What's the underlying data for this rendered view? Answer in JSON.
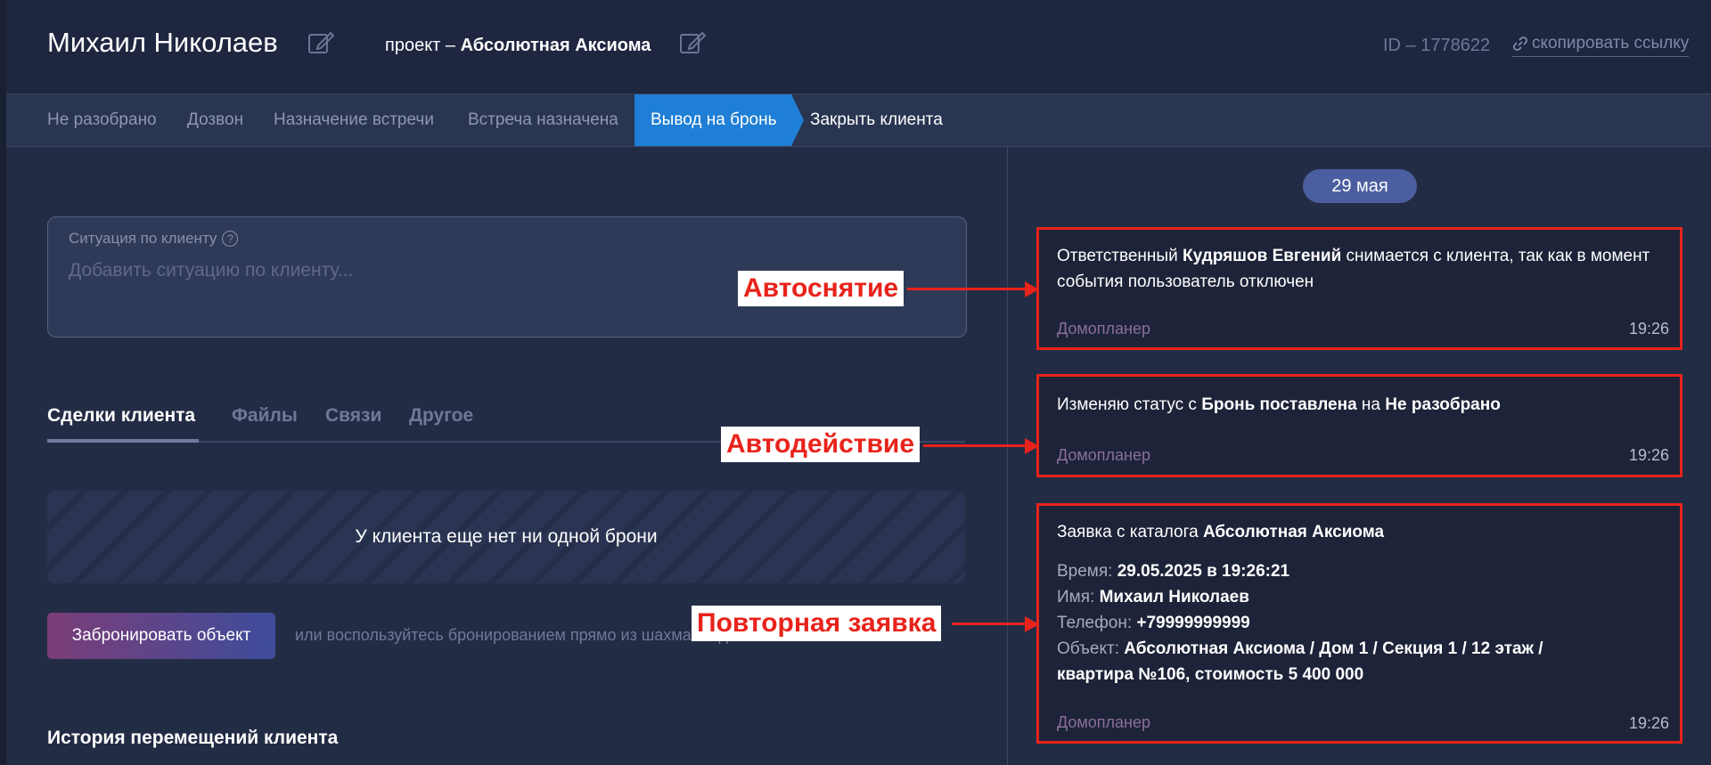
{
  "header": {
    "client_name": "Михаил Николаев",
    "project_prefix": "проект – ",
    "project_name": "Абсолютная Аксиома",
    "id_label": "ID – 1778622",
    "copy_link": "скопировать ссылку"
  },
  "stages": [
    "Не разобрано",
    "Дозвон",
    "Назначение встречи",
    "Встреча назначена",
    "Вывод на бронь",
    "Закрыть клиента"
  ],
  "situation": {
    "label": "Ситуация по клиенту",
    "placeholder": "Добавить ситуацию по клиенту..."
  },
  "tabs": [
    "Сделки клиента",
    "Файлы",
    "Связи",
    "Другое"
  ],
  "empty_text": "У клиента еще нет ни одной брони",
  "book_button": "Забронировать объект",
  "book_hint": "или воспользуйтесь бронированием прямо из шахматки дома",
  "history_title": "История перемещений клиента",
  "feed": {
    "date": "29 мая",
    "events": [
      {
        "pre": "Ответственный ",
        "bold": "Кудряшов Евгений",
        "post": " снимается с клиента, так как в момент события пользователь отключен",
        "source": "Домопланер",
        "time": "19:26"
      },
      {
        "pre": "Изменяю статус с ",
        "bold1": "Бронь поставлена",
        "mid": " на ",
        "bold2": "Не разобрано",
        "source": "Домопланер",
        "time": "19:26"
      },
      {
        "pre": "Заявка с каталога ",
        "bold": "Абсолютная Аксиома",
        "time_label": "Время: ",
        "time_value": "29.05.2025 в 19:26:21",
        "name_label": "Имя: ",
        "name_value": "Михаил Николаев",
        "phone_label": "Телефон: ",
        "phone_value": "+79999999999",
        "object_label": "Объект: ",
        "object_value_1": "Абсолютная Аксиома / Дом 1 / Секция 1 / 12 этаж /",
        "object_value_2": "квартира №106, стоимость 5 400 000",
        "source": "Домопланер",
        "time": "19:26"
      }
    ]
  },
  "annotations": [
    "Автоснятие",
    "Автодействие",
    "Повторная заявка"
  ],
  "colors": {
    "accent": "#1f7fd6",
    "annotation": "#e8231b"
  }
}
